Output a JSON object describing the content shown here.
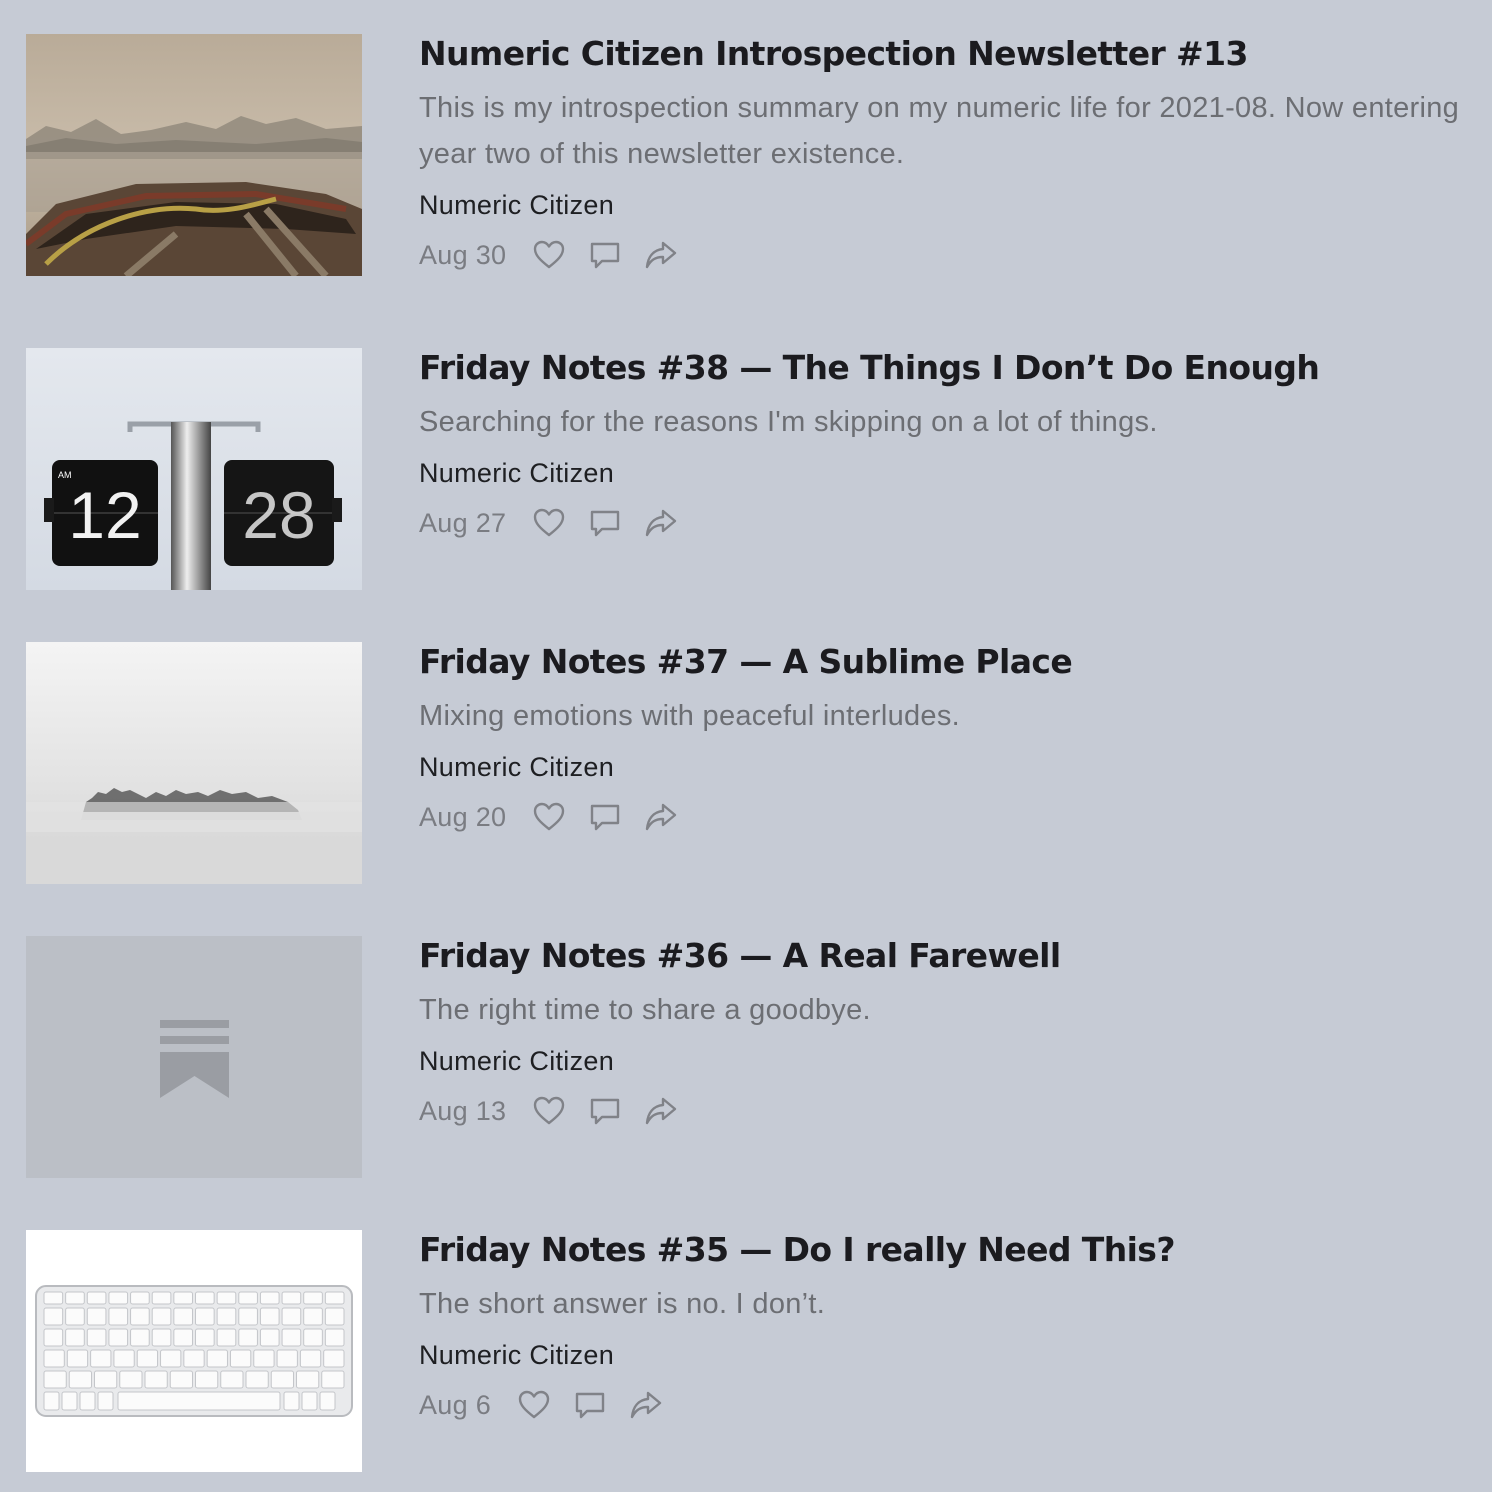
{
  "colors": {
    "background": "#c6cbd5",
    "title": "#1b1b1f",
    "subtitle": "#6c6e73",
    "icon": "#808288"
  },
  "icons": {
    "like": "heart-icon",
    "comment": "comment-icon",
    "share": "share-icon"
  },
  "posts": [
    {
      "title": "Numeric Citizen Introspection Newsletter #13",
      "subtitle": "This is my introspection summary on my numeric life for 2021-08. Now entering year two of this newsletter existence.",
      "author": "Numeric Citizen",
      "date": "Aug 30",
      "thumbnail": "boat-fog-image"
    },
    {
      "title": "Friday Notes #38 — The Things I Don’t Do Enough",
      "subtitle": "Searching for the reasons I'm skipping on a lot of things.",
      "author": "Numeric Citizen",
      "date": "Aug 27",
      "thumbnail": "flip-clock-image",
      "thumbnail_text": {
        "am": "AM",
        "hour": "12",
        "minute": "28"
      }
    },
    {
      "title": "Friday Notes #37 — A Sublime Place",
      "subtitle": "Mixing emotions with peaceful interludes.",
      "author": "Numeric Citizen",
      "date": "Aug 20",
      "thumbnail": "foggy-island-image"
    },
    {
      "title": "Friday Notes #36 — A Real Farewell",
      "subtitle": "The right time to share a goodbye.",
      "author": "Numeric Citizen",
      "date": "Aug 13",
      "thumbnail": "substack-placeholder-image"
    },
    {
      "title": "Friday Notes #35 — Do I really Need This?",
      "subtitle": "The short answer is no. I don’t.",
      "author": "Numeric Citizen",
      "date": "Aug 6",
      "thumbnail": "keyboard-image"
    }
  ]
}
